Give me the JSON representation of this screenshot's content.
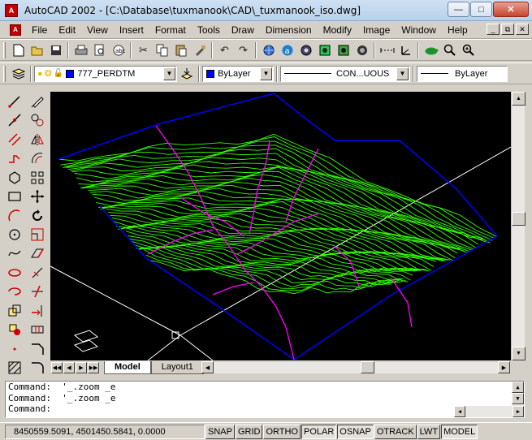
{
  "window": {
    "title": "AutoCAD 2002 - [C:\\Database\\tuxmanook\\CAD\\_tuxmanook_iso.dwg]",
    "app_icon_text": "A"
  },
  "menubar": {
    "items": [
      "File",
      "Edit",
      "View",
      "Insert",
      "Format",
      "Tools",
      "Draw",
      "Dimension",
      "Modify",
      "Image",
      "Window",
      "Help"
    ]
  },
  "standard_toolbar": {
    "icons": [
      "new-icon",
      "open-icon",
      "save-icon",
      "print-icon",
      "preview-icon",
      "spell-icon",
      "cut-icon",
      "copy-icon",
      "paste-icon",
      "matchprop-icon",
      "undo-icon",
      "redo-icon",
      "hyperlink-icon",
      "today-icon",
      "pan-icon",
      "zoom-realtime-icon",
      "zoom-window-icon",
      "zoom-previous-icon",
      "distance-icon",
      "ucs-icon",
      "turtle-icon",
      "zoom-icon",
      "zoom-in-icon"
    ]
  },
  "properties_toolbar": {
    "layer_name": "777_PERDTM",
    "color": "ByLayer",
    "linetype": "CON...UOUS",
    "lineweight": "ByLayer"
  },
  "tabs": {
    "model": "Model",
    "layout1": "Layout1"
  },
  "command_window": {
    "lines": [
      "Command:  '_.zoom _e",
      "Command:  '_.zoom _e",
      "Command:"
    ]
  },
  "status_bar": {
    "coordinates": "8450559.5091, 4501450.5841, 0.0000",
    "toggles": [
      "SNAP",
      "GRID",
      "ORTHO",
      "POLAR",
      "OSNAP",
      "OTRACK",
      "LWT",
      "MODEL"
    ]
  },
  "colors": {
    "contour": "#33ff00",
    "stream": "#ff00ff",
    "boundary": "#0000ff",
    "background": "#000000",
    "ucs_lines": "#ffffff"
  }
}
